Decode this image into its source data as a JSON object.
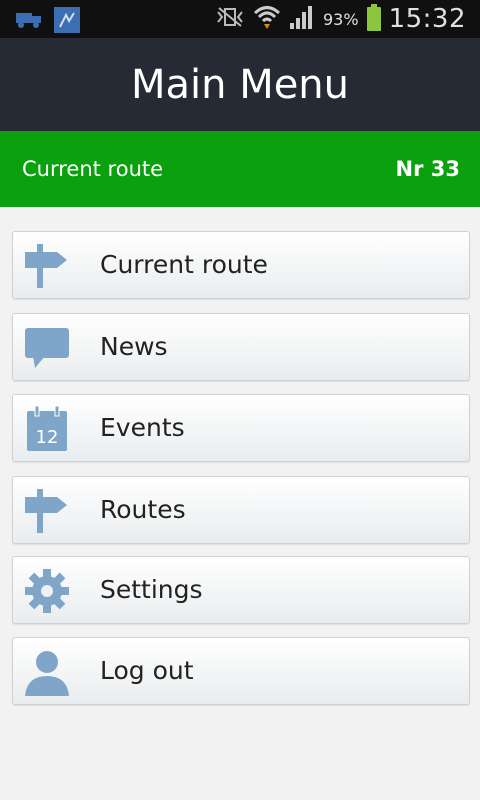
{
  "status_bar": {
    "battery_percent": "93%",
    "time": "15:32",
    "icons": [
      "truck-notification-icon",
      "app-notification-icon",
      "vibrate-icon",
      "wifi-icon",
      "signal-icon",
      "battery-icon"
    ]
  },
  "header": {
    "title": "Main Menu"
  },
  "route_bar": {
    "label": "Current route",
    "number": "Nr 33"
  },
  "menu": {
    "items": [
      {
        "label": "Current route",
        "icon": "signpost-icon"
      },
      {
        "label": "News",
        "icon": "speech-bubble-icon"
      },
      {
        "label": "Events",
        "icon": "calendar-icon",
        "icon_text": "12"
      },
      {
        "label": "Routes",
        "icon": "signpost-icon"
      },
      {
        "label": "Settings",
        "icon": "gear-icon"
      },
      {
        "label": "Log out",
        "icon": "person-icon"
      }
    ]
  },
  "colors": {
    "header_bg": "#252a34",
    "route_bar_bg": "#0aa00e",
    "icon_color": "#7fa5c9"
  }
}
